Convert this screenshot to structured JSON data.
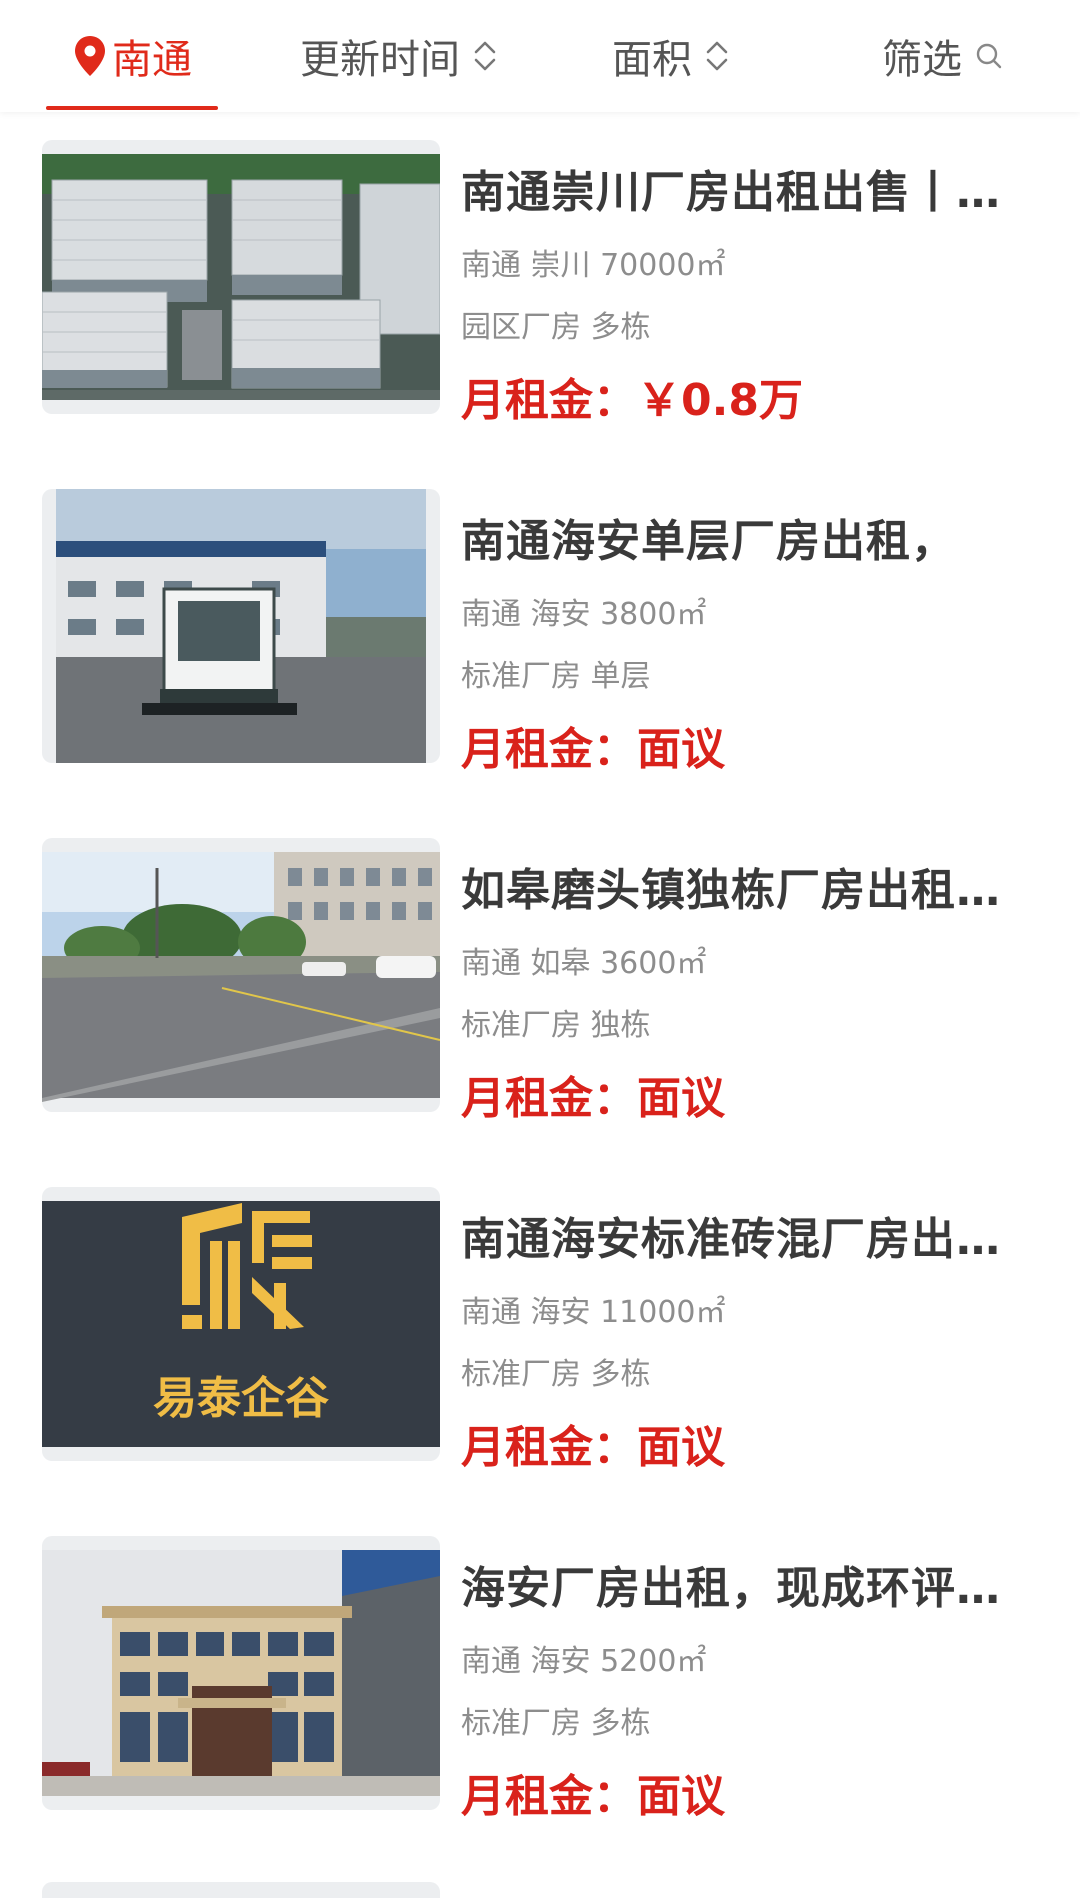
{
  "filter_bar": {
    "location": {
      "label": "南通",
      "icon": "location-pin-icon"
    },
    "update_time": {
      "label": "更新时间",
      "icon": "sort-icon"
    },
    "area": {
      "label": "面积",
      "icon": "sort-icon"
    },
    "filter": {
      "label": "筛选",
      "icon": "search-icon"
    }
  },
  "colors": {
    "accent": "#e02a1a",
    "price": "#d9221b",
    "title": "#3a3a3a",
    "meta": "#8d8d8d"
  },
  "listings": [
    {
      "title": "南通崇川厂房出租出售丨…",
      "location": "南通 崇川 70000㎡",
      "type": "园区厂房 多栋",
      "price": "月租金：￥0.8万",
      "image": "aerial-industrial-park-photo"
    },
    {
      "title": "南通海安单层厂房出租，",
      "location": "南通 海安 3800㎡",
      "type": "标准厂房 单层",
      "price": "月租金：面议",
      "image": "factory-with-sweeper-vehicle-photo"
    },
    {
      "title": "如皋磨头镇独栋厂房出租…",
      "location": "南通 如皋 3600㎡",
      "type": "标准厂房 独栋",
      "price": "月租金：面议",
      "image": "street-view-photo"
    },
    {
      "title": "南通海安标准砖混厂房出…",
      "location": "南通 海安 11000㎡",
      "type": "标准厂房 多栋",
      "price": "月租金：面议",
      "image": "yitai-qigu-logo",
      "logo_text": "易泰企谷"
    },
    {
      "title": "海安厂房出租，现成环评…",
      "location": "南通 海安 5200㎡",
      "type": "标准厂房 多栋",
      "price": "月租金：面议",
      "image": "office-building-photo"
    }
  ]
}
